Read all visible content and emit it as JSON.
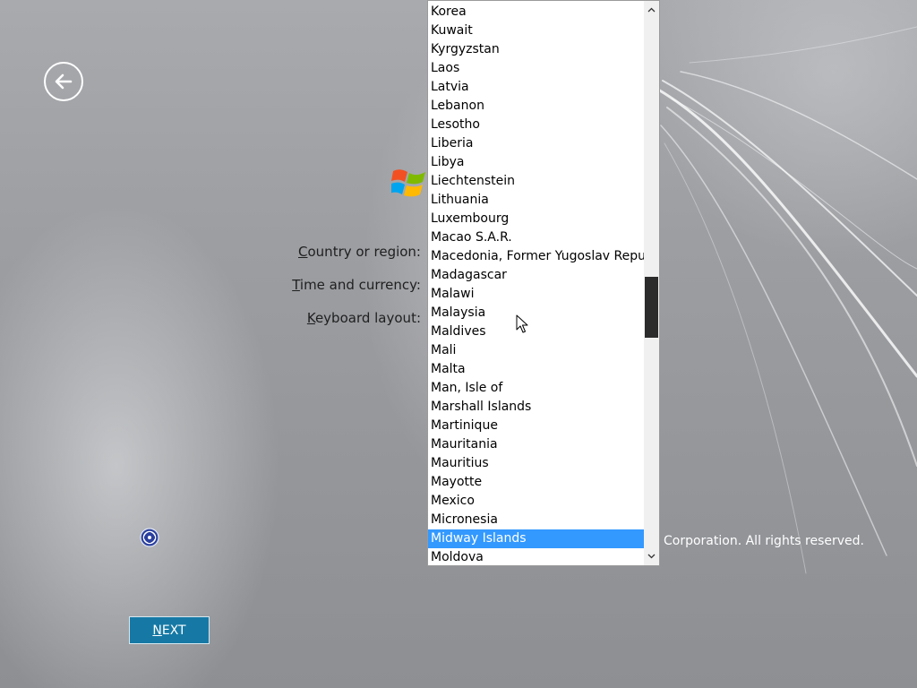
{
  "labels": {
    "country_accel": "C",
    "country_rest": "ountry or region:",
    "time_accel": "T",
    "time_rest": "ime and currency:",
    "keyboard_accel": "K",
    "keyboard_rest": "eyboard layout:"
  },
  "copyright": "Corporation.  All rights reserved.",
  "next_button": {
    "accel": "N",
    "rest": "EXT"
  },
  "dropdown": {
    "selected": "Midway Islands",
    "items": [
      "Korea",
      "Kuwait",
      "Kyrgyzstan",
      "Laos",
      "Latvia",
      "Lebanon",
      "Lesotho",
      "Liberia",
      "Libya",
      "Liechtenstein",
      "Lithuania",
      "Luxembourg",
      "Macao S.A.R.",
      "Macedonia, Former Yugoslav Republic of",
      "Madagascar",
      "Malawi",
      "Malaysia",
      "Maldives",
      "Mali",
      "Malta",
      "Man, Isle of",
      "Marshall Islands",
      "Martinique",
      "Mauritania",
      "Mauritius",
      "Mayotte",
      "Mexico",
      "Micronesia",
      "Midway Islands",
      "Moldova"
    ]
  },
  "icons": {
    "back": "back-arrow-icon",
    "logo": "windows-logo-icon",
    "ease_of_access": "ease-of-access-icon",
    "scroll_up": "chevron-up-icon",
    "scroll_down": "chevron-down-icon",
    "cursor": "mouse-pointer-icon"
  },
  "colors": {
    "accent": "#1679a5",
    "selection": "#3399ff"
  }
}
